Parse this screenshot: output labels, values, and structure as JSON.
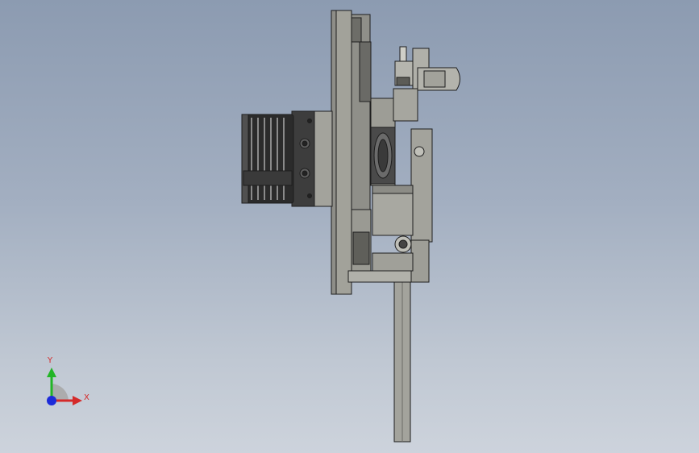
{
  "viewport": {
    "background_top": "#8c9bb1",
    "background_bottom": "#cdd3dc"
  },
  "model": {
    "part_color": "#a9a9a2",
    "edge_color": "#1e1e1e",
    "dark_color": "#3b3b3b"
  },
  "triad": {
    "x_label": "X",
    "y_label": "Y",
    "x_color": "#d42a2a",
    "y_color": "#22b526",
    "z_color": "#1c2bd9"
  }
}
